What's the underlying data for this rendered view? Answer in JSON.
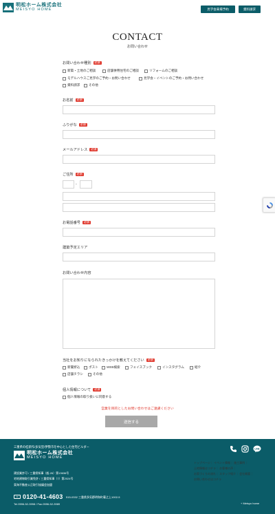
{
  "header": {
    "logo_jp": "明松ホーム株式会社",
    "logo_en": "MEISYO HOME",
    "visit_button": "見学会来場予約",
    "document_button": "資料請求"
  },
  "page": {
    "title": "CONTACT",
    "subtitle": "お問い合わせ"
  },
  "form": {
    "required_badge": "必須",
    "inquiry_type": {
      "label": "お問い合わせ種別",
      "options": [
        "新築・土地のご相談",
        "店舗併用住宅のご相談",
        "リフォームのご相談",
        "モデルハウスご見学のご予約・お問い合わせ",
        "見学会・イベントのご予約・お問い合わせ",
        "資料請求",
        "その他"
      ]
    },
    "name_label": "お名前",
    "kana_label": "ふりがな",
    "email_label": "メールアドレス",
    "address_label": "ご住所",
    "zip_separator": "-",
    "phone_label": "お電話番号",
    "area_label": "建築予定エリア",
    "message_label": "お問い合わせ内容",
    "source": {
      "label": "当社をお知りになられたきっかけを教えてください",
      "options": [
        "新聞折込",
        "ポスト",
        "WEB検索",
        "フェイスブック",
        "インスタグラム",
        "紹介",
        "店舗チラシ",
        "その他"
      ]
    },
    "privacy": {
      "label": "個人情報について",
      "checkbox": "個人情報の取り扱いに同意する"
    },
    "warning": "営業を目的としたお問い合わせはご遠慮ください",
    "submit_label": "送信する"
  },
  "footer": {
    "tagline": "三重県の桂新作/多気型/伊勢市を中心とした住宅ビルダー",
    "logo_jp": "明松ホーム株式会社",
    "logo_en": "MEISYO HOME",
    "license1": "建設業許可 / 三重県知事（般-26）第13636号",
    "license2": "宅地建物取引業免許 / 三重県知事（7）第2024号",
    "license3": "東海不動産公正取引協議会加盟",
    "phone": "0120-41-4603",
    "address": "515-0332 三重県多気郡明和町蓑之上1002-5",
    "tel_fax": "Tel.0596-52-3998 / Fax.0596-52-3989",
    "links": [
      "トップページ｜ イベント情報｜ 施工事例｜",
      "土地情報はコチラ｜ お客様の声｜",
      "お家づくりの流れ｜ スタッフ紹介｜ 会社概要｜",
      "お問い合わせはコチラ"
    ],
    "meisyo_link": "+ Meisyo home"
  }
}
